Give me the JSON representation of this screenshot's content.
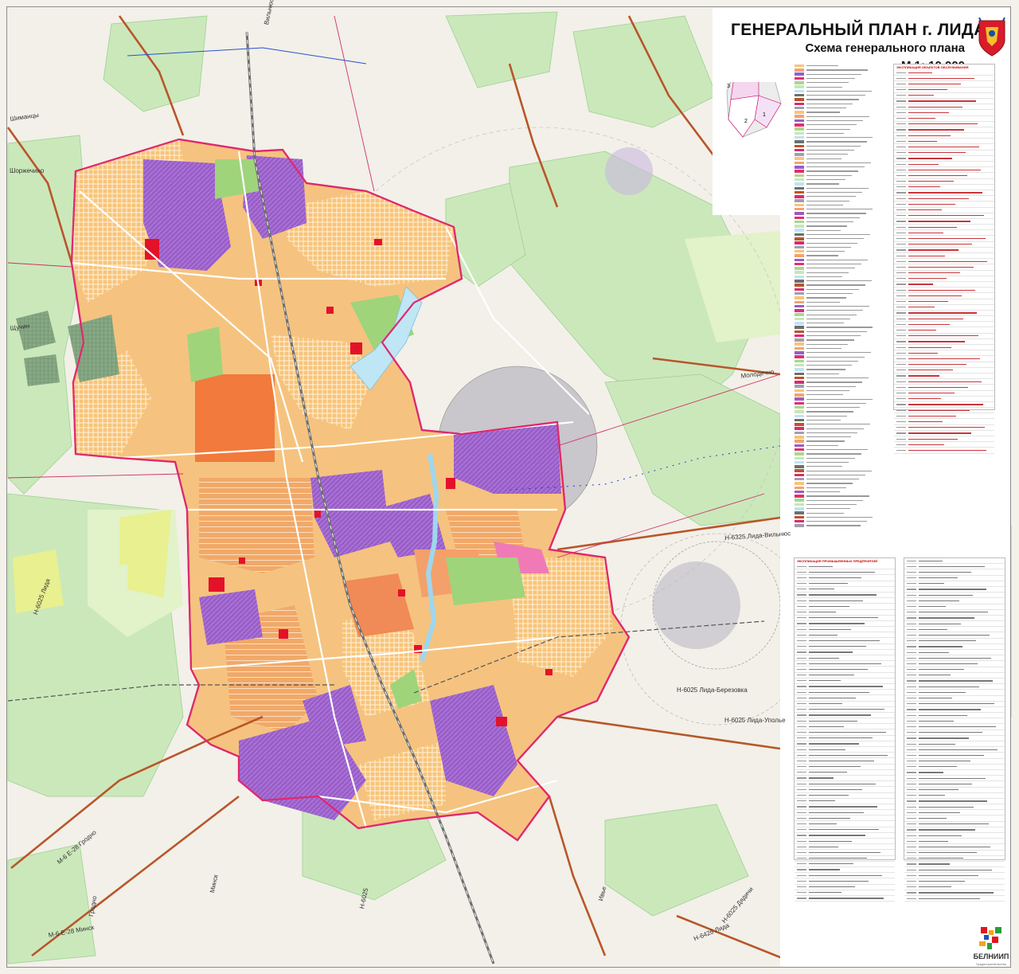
{
  "title": {
    "main": "ГЕНЕРАЛЬНЫЙ ПЛАН г. ЛИДА",
    "subtitle": "Схема генерального плана",
    "scale": "М 1: 10 000"
  },
  "roads": [
    {
      "label": "Н-6025 Лида-Уполье",
      "angle": 0
    },
    {
      "label": "Н-6325 Лида-Вильнюс",
      "angle": -4
    },
    {
      "label": "Н-6025 Лида-Березовка",
      "angle": 0
    },
    {
      "label": "Молодечно",
      "angle": -8
    },
    {
      "label": "М-6 Е-28 Минск",
      "angle": -10
    },
    {
      "label": "Н-6426 Лида",
      "angle": -22
    },
    {
      "label": "Минск",
      "angle": -78
    },
    {
      "label": "Гродно",
      "angle": -80
    },
    {
      "label": "Вильнюс",
      "angle": -78
    },
    {
      "label": "Н-6025",
      "angle": -78
    },
    {
      "label": "Ивье",
      "angle": -75
    },
    {
      "label": "Шиманцы",
      "angle": -8
    },
    {
      "label": "Шоржечино",
      "angle": 0
    },
    {
      "label": "Щучин",
      "angle": -8
    },
    {
      "label": "Н-6025 Дядичи",
      "angle": -50
    },
    {
      "label": "М-6 Е-28 Гродно",
      "angle": -40
    },
    {
      "label": "Н-6025 Лида",
      "angle": -70
    }
  ],
  "inset": {
    "zones": [
      "4",
      "3",
      "1",
      "2"
    ]
  },
  "legend_lists": {
    "col1_title": "ЭКСПЛИКАЦИЯ ОБЪЕКТОВ ОБСЛУЖИВАНИЯ",
    "col2_title": "ЭКСПЛИКАЦИЯ ПРОМЫШЛЕННЫХ ПРЕДПРИЯТИЙ"
  },
  "logo": {
    "name": "БЕЛНИИП",
    "sub": "Градостроительство"
  },
  "colors": {
    "residential_low": "#f7c47a",
    "residential_mid": "#f3a56a",
    "industrial": "#9b5bc8",
    "public": "#e03070",
    "greenery": "#a9d88c",
    "forest": "#c6e6b8",
    "water": "#bfe3f2",
    "rail": "#6e6e6e",
    "highway": "#b8562a",
    "boundary": "#e0286e",
    "sanitary_zone": "#9f9faf"
  }
}
